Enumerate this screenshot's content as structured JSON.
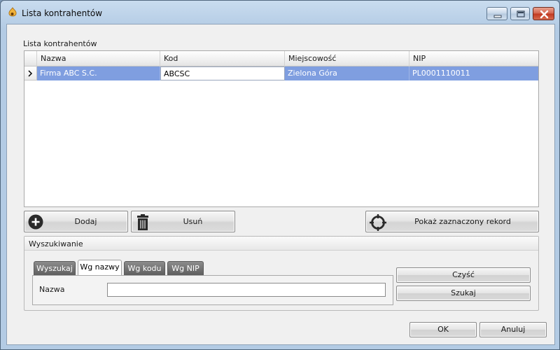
{
  "window": {
    "title": "Lista kontrahentów"
  },
  "list_label": "Lista kontrahentów",
  "grid": {
    "columns": [
      "Nazwa",
      "Kod",
      "Miejscowość",
      "NIP"
    ],
    "rows": [
      {
        "name": "Firma ABC S.C.",
        "code": "ABCSC",
        "city": "Zielona Góra",
        "nip": "PL0001110011"
      }
    ]
  },
  "actions": {
    "add_label": "Dodaj",
    "delete_label": "Usuń",
    "show_label": "Pokaż zaznaczony rekord"
  },
  "search": {
    "group_title": "Wyszukiwanie",
    "tabs": [
      "Wyszukaj",
      "Wg nazwy",
      "Wg kodu",
      "Wg NIP"
    ],
    "active_tab": "Wg nazwy",
    "field_label": "Nazwa",
    "field_value": "",
    "clear_label": "Czyść",
    "search_label": "Szukaj"
  },
  "footer": {
    "ok_label": "OK",
    "cancel_label": "Anuluj"
  },
  "colors": {
    "selection": "#7f9ee0",
    "close_button": "#c0371f"
  }
}
